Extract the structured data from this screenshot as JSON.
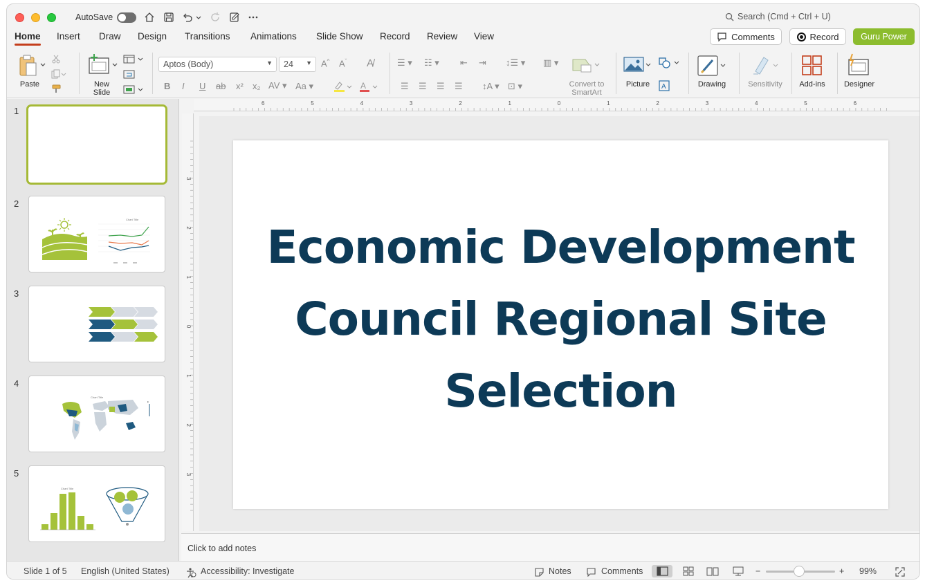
{
  "titlebar": {
    "autosave_label": "AutoSave",
    "search_placeholder": "Search (Cmd + Ctrl + U)"
  },
  "tabs": [
    "Home",
    "Insert",
    "Draw",
    "Design",
    "Transitions",
    "Animations",
    "Slide Show",
    "Record",
    "Review",
    "View"
  ],
  "header_buttons": {
    "comments": "Comments",
    "record": "Record",
    "guru": "Guru Power"
  },
  "colors": {
    "accent_tab": "#c43e1c",
    "guru_green": "#8cbc2e",
    "title_navy": "#0d3a57",
    "thumb_green": "#a5c23a",
    "thumb_navy": "#1f5a80"
  },
  "ribbon": {
    "paste": "Paste",
    "new_slide_line1": "New",
    "new_slide_line2": "Slide",
    "font_name": "Aptos (Body)",
    "font_size": "24",
    "convert_line1": "Convert to",
    "convert_line2": "SmartArt",
    "picture": "Picture",
    "drawing": "Drawing",
    "sensitivity": "Sensitivity",
    "addins": "Add-ins",
    "designer": "Designer"
  },
  "thumbnails": [
    {
      "num": "1"
    },
    {
      "num": "2",
      "chart_title": "Chart Title"
    },
    {
      "num": "3"
    },
    {
      "num": "4",
      "chart_title": "Chart Title"
    },
    {
      "num": "5",
      "chart_title": "Chart Title"
    }
  ],
  "ruler": {
    "h_ticks": [
      "6",
      "5",
      "4",
      "3",
      "2",
      "1",
      "0",
      "1",
      "2",
      "3",
      "4",
      "5",
      "6"
    ],
    "v_ticks": [
      "3",
      "2",
      "1",
      "0",
      "1",
      "2",
      "3"
    ]
  },
  "slide": {
    "title_line1": "Economic Development",
    "title_line2": "Council Regional Site",
    "title_line3": "Selection"
  },
  "notes_placeholder": "Click to add notes",
  "status": {
    "slide_count": "Slide 1 of 5",
    "language": "English (United States)",
    "accessibility": "Accessibility: Investigate",
    "notes": "Notes",
    "comments": "Comments",
    "zoom": "99%"
  }
}
